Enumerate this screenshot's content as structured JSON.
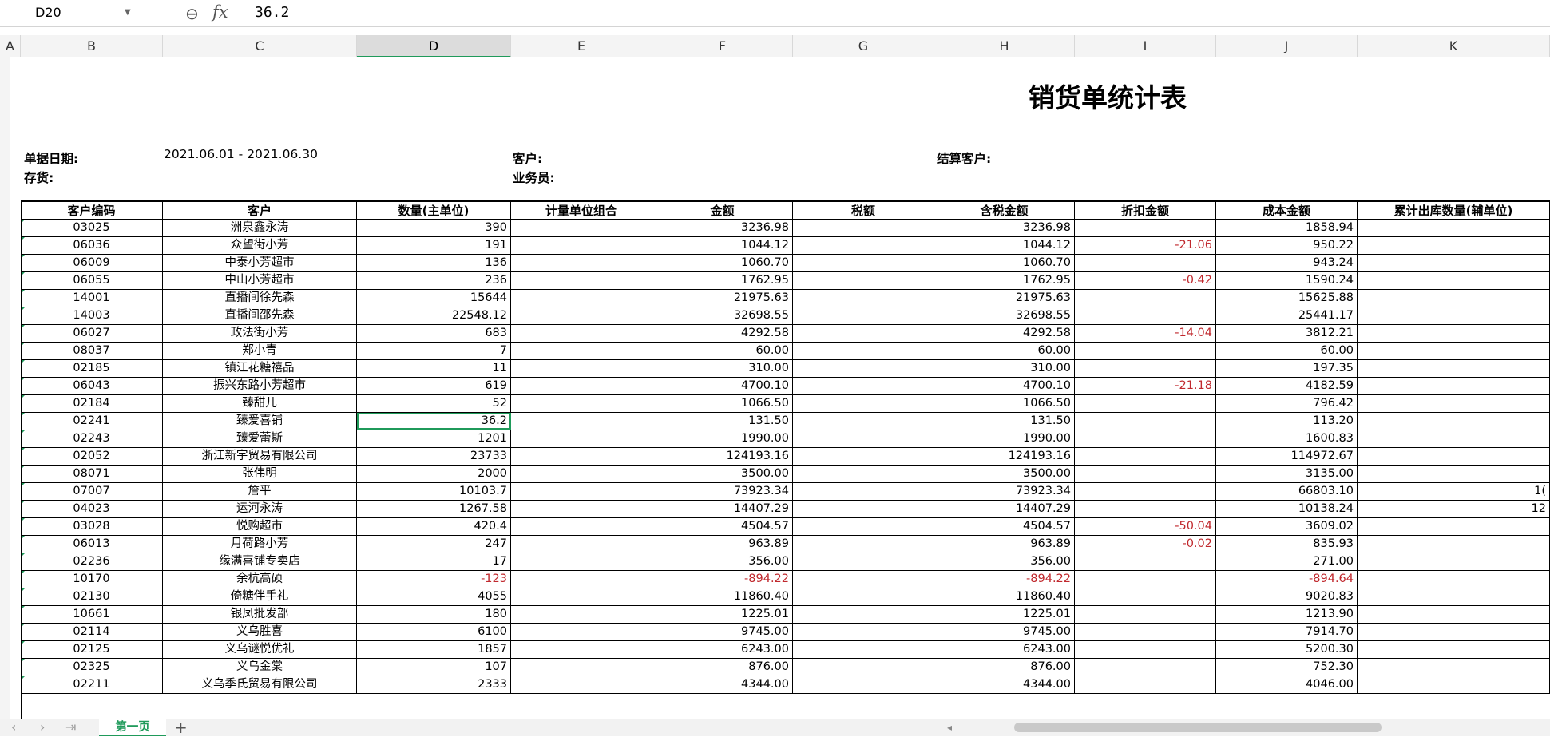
{
  "formula_bar": {
    "cell_ref": "D20",
    "formula_value": "36.2",
    "fx_label": "fx"
  },
  "columns": [
    {
      "letter": "A",
      "active": false
    },
    {
      "letter": "B",
      "active": false
    },
    {
      "letter": "C",
      "active": false
    },
    {
      "letter": "D",
      "active": true
    },
    {
      "letter": "E",
      "active": false
    },
    {
      "letter": "F",
      "active": false
    },
    {
      "letter": "G",
      "active": false
    },
    {
      "letter": "H",
      "active": false
    },
    {
      "letter": "I",
      "active": false
    },
    {
      "letter": "J",
      "active": false
    },
    {
      "letter": "K",
      "active": false
    }
  ],
  "report": {
    "title": "销货单统计表",
    "date_label": "单据日期:",
    "date_value": "2021.06.01 - 2021.06.30",
    "inventory_label": "存货:",
    "customer_label": "客户:",
    "salesperson_label": "业务员:",
    "settle_customer_label": "结算客户:"
  },
  "table": {
    "headers": [
      "客户编码",
      "客户",
      "数量(主单位)",
      "计量单位组合",
      "金额",
      "税额",
      "含税金额",
      "折扣金额",
      "成本金额",
      "累计出库数量(辅单位)"
    ],
    "rows": [
      {
        "code": "03025",
        "customer": "洲泉鑫永涛",
        "qty": "390",
        "unit": "",
        "amount": "3236.98",
        "tax": "",
        "amount_tax": "3236.98",
        "discount": "",
        "cost": "1858.94",
        "cum": "",
        "qty_neg": false,
        "amt_neg": false,
        "disc_neg": false,
        "cost_neg": false,
        "selected": false
      },
      {
        "code": "06036",
        "customer": "众望街小芳",
        "qty": "191",
        "unit": "",
        "amount": "1044.12",
        "tax": "",
        "amount_tax": "1044.12",
        "discount": "-21.06",
        "cost": "950.22",
        "cum": "",
        "qty_neg": false,
        "amt_neg": false,
        "disc_neg": true,
        "cost_neg": false,
        "selected": false
      },
      {
        "code": "06009",
        "customer": "中泰小芳超市",
        "qty": "136",
        "unit": "",
        "amount": "1060.70",
        "tax": "",
        "amount_tax": "1060.70",
        "discount": "",
        "cost": "943.24",
        "cum": "",
        "qty_neg": false,
        "amt_neg": false,
        "disc_neg": false,
        "cost_neg": false,
        "selected": false
      },
      {
        "code": "06055",
        "customer": "中山小芳超市",
        "qty": "236",
        "unit": "",
        "amount": "1762.95",
        "tax": "",
        "amount_tax": "1762.95",
        "discount": "-0.42",
        "cost": "1590.24",
        "cum": "",
        "qty_neg": false,
        "amt_neg": false,
        "disc_neg": true,
        "cost_neg": false,
        "selected": false
      },
      {
        "code": "14001",
        "customer": "直播间徐先森",
        "qty": "15644",
        "unit": "",
        "amount": "21975.63",
        "tax": "",
        "amount_tax": "21975.63",
        "discount": "",
        "cost": "15625.88",
        "cum": "",
        "qty_neg": false,
        "amt_neg": false,
        "disc_neg": false,
        "cost_neg": false,
        "selected": false
      },
      {
        "code": "14003",
        "customer": "直播间邵先森",
        "qty": "22548.12",
        "unit": "",
        "amount": "32698.55",
        "tax": "",
        "amount_tax": "32698.55",
        "discount": "",
        "cost": "25441.17",
        "cum": "",
        "qty_neg": false,
        "amt_neg": false,
        "disc_neg": false,
        "cost_neg": false,
        "selected": false
      },
      {
        "code": "06027",
        "customer": "政法街小芳",
        "qty": "683",
        "unit": "",
        "amount": "4292.58",
        "tax": "",
        "amount_tax": "4292.58",
        "discount": "-14.04",
        "cost": "3812.21",
        "cum": "",
        "qty_neg": false,
        "amt_neg": false,
        "disc_neg": true,
        "cost_neg": false,
        "selected": false
      },
      {
        "code": "08037",
        "customer": "郑小青",
        "qty": "7",
        "unit": "",
        "amount": "60.00",
        "tax": "",
        "amount_tax": "60.00",
        "discount": "",
        "cost": "60.00",
        "cum": "",
        "qty_neg": false,
        "amt_neg": false,
        "disc_neg": false,
        "cost_neg": false,
        "selected": false
      },
      {
        "code": "02185",
        "customer": "镇江花糖禧品",
        "qty": "11",
        "unit": "",
        "amount": "310.00",
        "tax": "",
        "amount_tax": "310.00",
        "discount": "",
        "cost": "197.35",
        "cum": "",
        "qty_neg": false,
        "amt_neg": false,
        "disc_neg": false,
        "cost_neg": false,
        "selected": false
      },
      {
        "code": "06043",
        "customer": "振兴东路小芳超市",
        "qty": "619",
        "unit": "",
        "amount": "4700.10",
        "tax": "",
        "amount_tax": "4700.10",
        "discount": "-21.18",
        "cost": "4182.59",
        "cum": "",
        "qty_neg": false,
        "amt_neg": false,
        "disc_neg": true,
        "cost_neg": false,
        "selected": false
      },
      {
        "code": "02184",
        "customer": "臻甜儿",
        "qty": "52",
        "unit": "",
        "amount": "1066.50",
        "tax": "",
        "amount_tax": "1066.50",
        "discount": "",
        "cost": "796.42",
        "cum": "",
        "qty_neg": false,
        "amt_neg": false,
        "disc_neg": false,
        "cost_neg": false,
        "selected": false
      },
      {
        "code": "02241",
        "customer": "臻爱喜铺",
        "qty": "36.2",
        "unit": "",
        "amount": "131.50",
        "tax": "",
        "amount_tax": "131.50",
        "discount": "",
        "cost": "113.20",
        "cum": "",
        "qty_neg": false,
        "amt_neg": false,
        "disc_neg": false,
        "cost_neg": false,
        "selected": true
      },
      {
        "code": "02243",
        "customer": "臻爱蕾斯",
        "qty": "1201",
        "unit": "",
        "amount": "1990.00",
        "tax": "",
        "amount_tax": "1990.00",
        "discount": "",
        "cost": "1600.83",
        "cum": "",
        "qty_neg": false,
        "amt_neg": false,
        "disc_neg": false,
        "cost_neg": false,
        "selected": false
      },
      {
        "code": "02052",
        "customer": "浙江新宇贸易有限公司",
        "qty": "23733",
        "unit": "",
        "amount": "124193.16",
        "tax": "",
        "amount_tax": "124193.16",
        "discount": "",
        "cost": "114972.67",
        "cum": "",
        "qty_neg": false,
        "amt_neg": false,
        "disc_neg": false,
        "cost_neg": false,
        "selected": false
      },
      {
        "code": "08071",
        "customer": "张伟明",
        "qty": "2000",
        "unit": "",
        "amount": "3500.00",
        "tax": "",
        "amount_tax": "3500.00",
        "discount": "",
        "cost": "3135.00",
        "cum": "",
        "qty_neg": false,
        "amt_neg": false,
        "disc_neg": false,
        "cost_neg": false,
        "selected": false
      },
      {
        "code": "07007",
        "customer": "詹平",
        "qty": "10103.7",
        "unit": "",
        "amount": "73923.34",
        "tax": "",
        "amount_tax": "73923.34",
        "discount": "",
        "cost": "66803.10",
        "cum": "1(",
        "qty_neg": false,
        "amt_neg": false,
        "disc_neg": false,
        "cost_neg": false,
        "selected": false
      },
      {
        "code": "04023",
        "customer": "运河永涛",
        "qty": "1267.58",
        "unit": "",
        "amount": "14407.29",
        "tax": "",
        "amount_tax": "14407.29",
        "discount": "",
        "cost": "10138.24",
        "cum": "12",
        "qty_neg": false,
        "amt_neg": false,
        "disc_neg": false,
        "cost_neg": false,
        "selected": false
      },
      {
        "code": "03028",
        "customer": "悦购超市",
        "qty": "420.4",
        "unit": "",
        "amount": "4504.57",
        "tax": "",
        "amount_tax": "4504.57",
        "discount": "-50.04",
        "cost": "3609.02",
        "cum": "",
        "qty_neg": false,
        "amt_neg": false,
        "disc_neg": true,
        "cost_neg": false,
        "selected": false
      },
      {
        "code": "06013",
        "customer": "月荷路小芳",
        "qty": "247",
        "unit": "",
        "amount": "963.89",
        "tax": "",
        "amount_tax": "963.89",
        "discount": "-0.02",
        "cost": "835.93",
        "cum": "",
        "qty_neg": false,
        "amt_neg": false,
        "disc_neg": true,
        "cost_neg": false,
        "selected": false
      },
      {
        "code": "02236",
        "customer": "缘满喜铺专卖店",
        "qty": "17",
        "unit": "",
        "amount": "356.00",
        "tax": "",
        "amount_tax": "356.00",
        "discount": "",
        "cost": "271.00",
        "cum": "",
        "qty_neg": false,
        "amt_neg": false,
        "disc_neg": false,
        "cost_neg": false,
        "selected": false
      },
      {
        "code": "10170",
        "customer": "余杭高硕",
        "qty": "-123",
        "unit": "",
        "amount": "-894.22",
        "tax": "",
        "amount_tax": "-894.22",
        "discount": "",
        "cost": "-894.64",
        "cum": "",
        "qty_neg": true,
        "amt_neg": true,
        "disc_neg": false,
        "cost_neg": true,
        "selected": false
      },
      {
        "code": "02130",
        "customer": "倚糖伴手礼",
        "qty": "4055",
        "unit": "",
        "amount": "11860.40",
        "tax": "",
        "amount_tax": "11860.40",
        "discount": "",
        "cost": "9020.83",
        "cum": "",
        "qty_neg": false,
        "amt_neg": false,
        "disc_neg": false,
        "cost_neg": false,
        "selected": false
      },
      {
        "code": "10661",
        "customer": "银凤批发部",
        "qty": "180",
        "unit": "",
        "amount": "1225.01",
        "tax": "",
        "amount_tax": "1225.01",
        "discount": "",
        "cost": "1213.90",
        "cum": "",
        "qty_neg": false,
        "amt_neg": false,
        "disc_neg": false,
        "cost_neg": false,
        "selected": false
      },
      {
        "code": "02114",
        "customer": "义乌胜喜",
        "qty": "6100",
        "unit": "",
        "amount": "9745.00",
        "tax": "",
        "amount_tax": "9745.00",
        "discount": "",
        "cost": "7914.70",
        "cum": "",
        "qty_neg": false,
        "amt_neg": false,
        "disc_neg": false,
        "cost_neg": false,
        "selected": false
      },
      {
        "code": "02125",
        "customer": "义乌谜悦优礼",
        "qty": "1857",
        "unit": "",
        "amount": "6243.00",
        "tax": "",
        "amount_tax": "6243.00",
        "discount": "",
        "cost": "5200.30",
        "cum": "",
        "qty_neg": false,
        "amt_neg": false,
        "disc_neg": false,
        "cost_neg": false,
        "selected": false
      },
      {
        "code": "02325",
        "customer": "义乌金棠",
        "qty": "107",
        "unit": "",
        "amount": "876.00",
        "tax": "",
        "amount_tax": "876.00",
        "discount": "",
        "cost": "752.30",
        "cum": "",
        "qty_neg": false,
        "amt_neg": false,
        "disc_neg": false,
        "cost_neg": false,
        "selected": false
      },
      {
        "code": "02211",
        "customer": "义乌季氏贸易有限公司",
        "qty": "2333",
        "unit": "",
        "amount": "4344.00",
        "tax": "",
        "amount_tax": "4344.00",
        "discount": "",
        "cost": "4046.00",
        "cum": "",
        "qty_neg": false,
        "amt_neg": false,
        "disc_neg": false,
        "cost_neg": false,
        "selected": false
      }
    ]
  },
  "sheet_tabs": {
    "active_tab": "第一页",
    "add_symbol": "+",
    "nav_prev": "‹",
    "nav_next": "›",
    "nav_last": "⇥"
  },
  "accent_color": "#1f9a5a",
  "negative_color": "#c0282d"
}
